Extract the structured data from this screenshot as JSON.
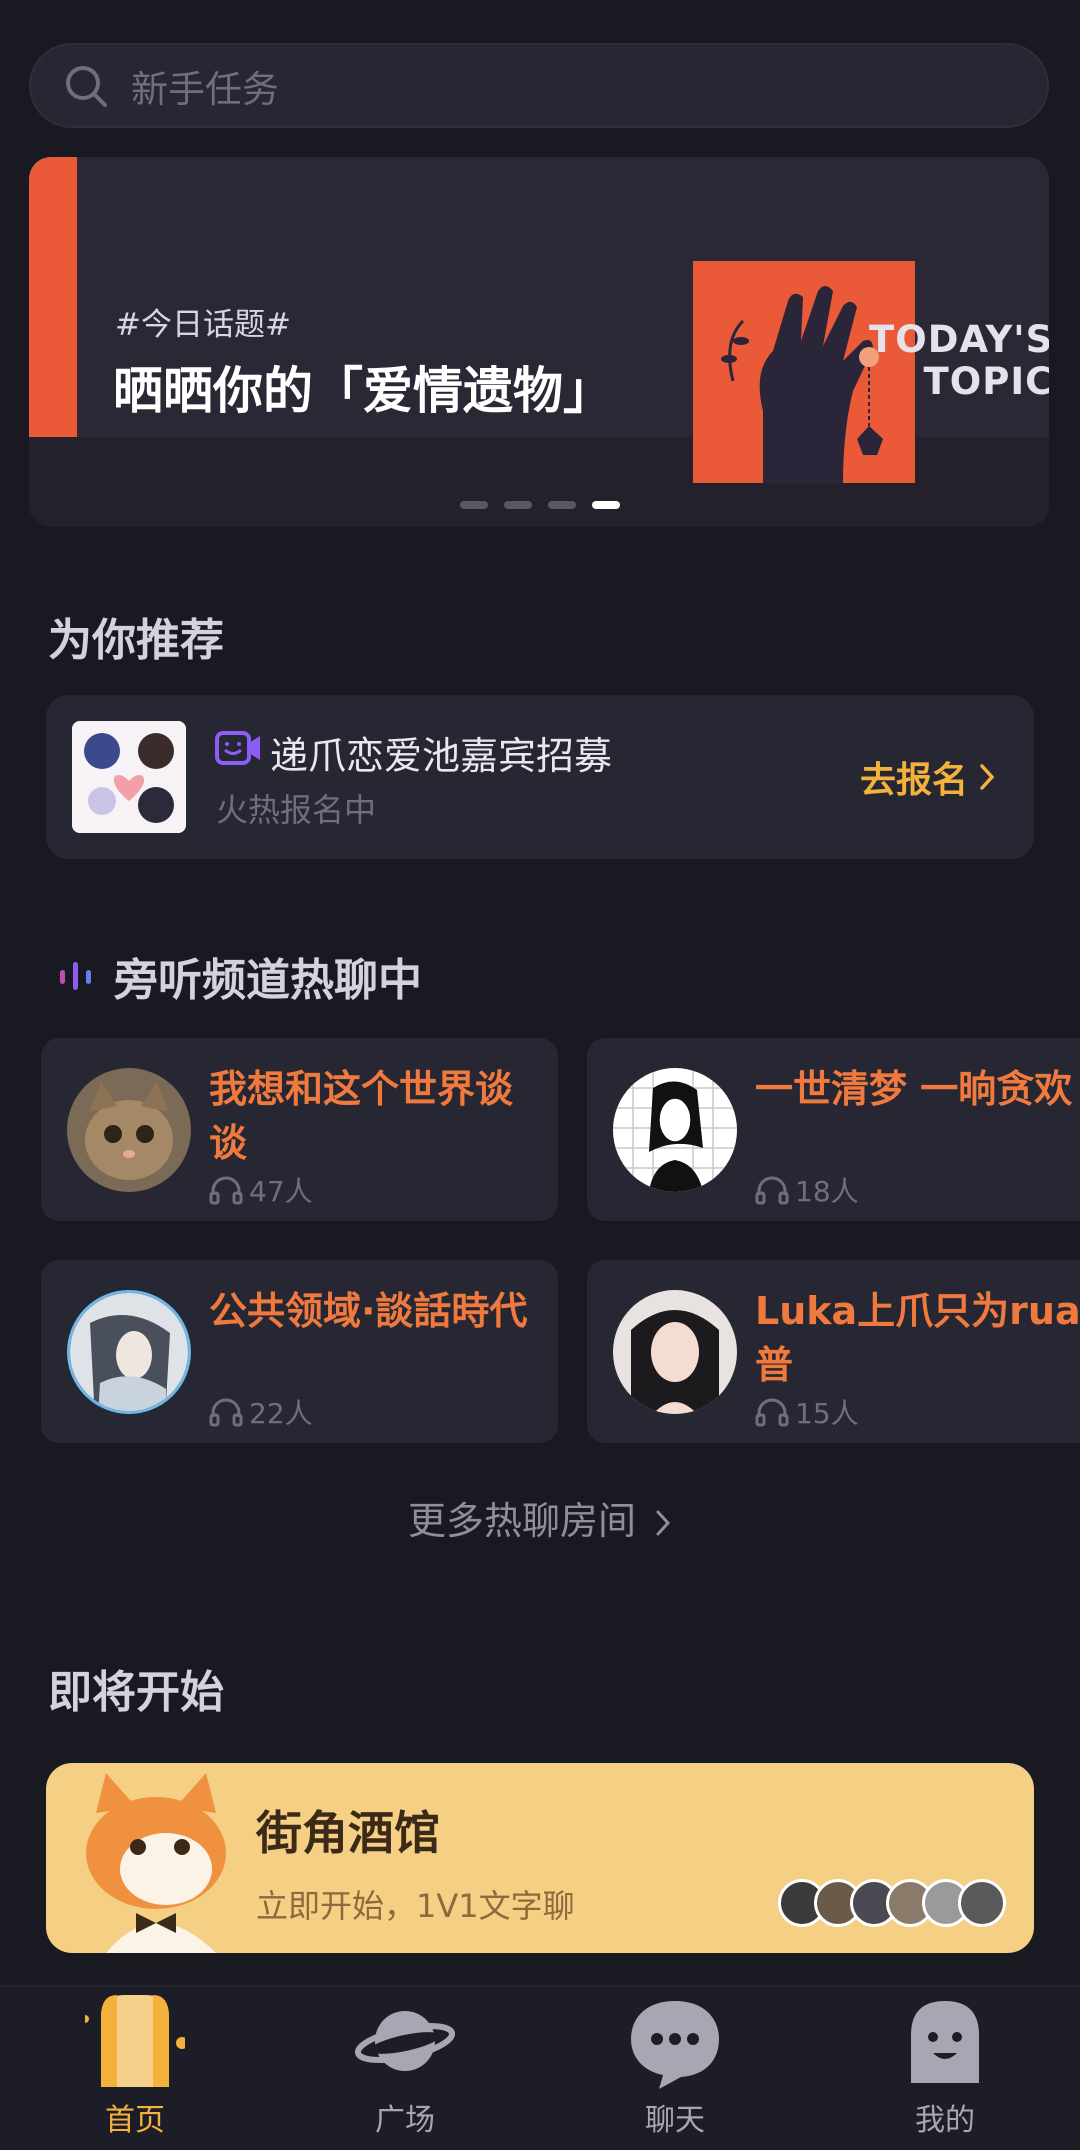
{
  "search": {
    "placeholder": "新手任务"
  },
  "banner": {
    "tag": "#今日话题#",
    "title": "晒晒你的「爱情遗物」",
    "topic_line1": "TODAY'S",
    "topic_line2": "TOPIC",
    "dots": 4,
    "active_dot": 4,
    "accent": "#eb5a38"
  },
  "recommend": {
    "section_title": "为你推荐",
    "title": "递爪恋爱池嘉宾招募",
    "subtitle": "火热报名中",
    "cta": "去报名"
  },
  "hot": {
    "section_title": "旁听频道热聊中",
    "rooms": [
      {
        "name": "我想和这个世界谈谈",
        "count": "47人"
      },
      {
        "name": "一世清梦 一晌贪欢",
        "count": "18人"
      },
      {
        "name": "公共领域·談話時代",
        "count": "22人"
      },
      {
        "name": "Luka上爪只为rua普",
        "count": "15人"
      }
    ],
    "more": "更多热聊房间"
  },
  "upcoming": {
    "section_title": "即将开始",
    "title": "街角酒馆",
    "subtitle": "立即开始，1V1文字聊"
  },
  "tabs": [
    {
      "label": "首页",
      "icon": "home-curtain-icon",
      "active": true
    },
    {
      "label": "广场",
      "icon": "planet-icon",
      "active": false
    },
    {
      "label": "聊天",
      "icon": "chat-bubble-icon",
      "active": false
    },
    {
      "label": "我的",
      "icon": "ghost-profile-icon",
      "active": false
    }
  ],
  "colors": {
    "background": "#191922",
    "card": "#272734",
    "accent_orange": "#f07a3d",
    "accent_yellow": "#f4b23c",
    "upcoming_card": "#f5cf84"
  }
}
